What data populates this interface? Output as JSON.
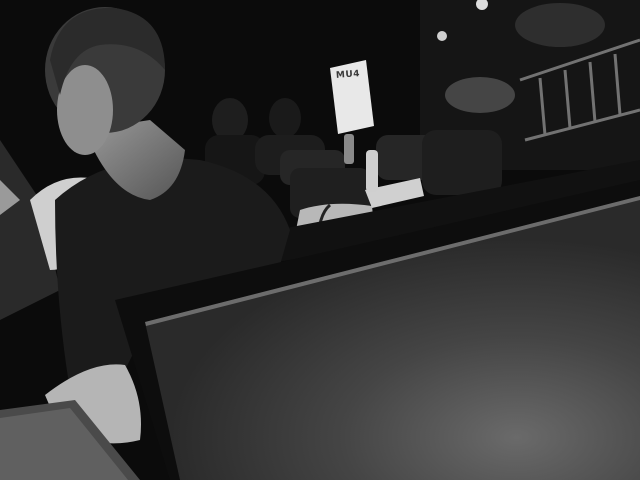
{
  "scene": {
    "banner_text": "MU4"
  },
  "terminal": {
    "lines": [
      "",
      "",
      "",
      "",
      "",
      "",
      "",
      "",
      "",
      "",
      ""
    ]
  },
  "colors": {
    "background": "#0b0b0b",
    "screen": "#3c3c3c",
    "terminal_text": "#eeeeee"
  }
}
